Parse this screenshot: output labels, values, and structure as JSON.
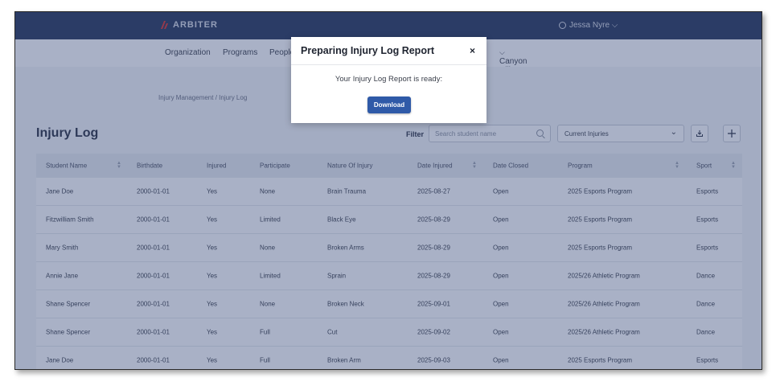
{
  "topbar": {
    "brand": "ARBITER",
    "user_name": "Jessa Nyre ⌵"
  },
  "subnav": {
    "items": [
      "Organization",
      "Programs",
      "People",
      "Canyon Hills High School Acco"
    ]
  },
  "breadcrumb": "Injury Management  /  Injury Log",
  "page": {
    "title": "Injury Log",
    "filter_label": "Filter",
    "search_placeholder": "Search student name",
    "status_filter": "Current Injuries"
  },
  "table": {
    "columns": [
      "Student Name",
      "Birthdate",
      "Injured",
      "Participate",
      "Nature Of Injury",
      "Date Injured",
      "Date Closed",
      "Program",
      "Sport"
    ],
    "rows": [
      [
        "Jane Doe",
        "2000-01-01",
        "Yes",
        "None",
        "Brain Trauma",
        "2025-08-27",
        "Open",
        "2025 Esports Program",
        "Esports"
      ],
      [
        "Fitzwilliam Smith",
        "2000-01-01",
        "Yes",
        "Limited",
        "Black Eye",
        "2025-08-29",
        "Open",
        "2025 Esports Program",
        "Esports"
      ],
      [
        "Mary Smith",
        "2000-01-01",
        "Yes",
        "None",
        "Broken Arms",
        "2025-08-29",
        "Open",
        "2025 Esports Program",
        "Esports"
      ],
      [
        "Annie Jane",
        "2000-01-01",
        "Yes",
        "Limited",
        "Sprain",
        "2025-08-29",
        "Open",
        "2025/26 Athletic Program",
        "Dance"
      ],
      [
        "Shane Spencer",
        "2000-01-01",
        "Yes",
        "None",
        "Broken Neck",
        "2025-09-01",
        "Open",
        "2025/26 Athletic Program",
        "Dance"
      ],
      [
        "Shane Spencer",
        "2000-01-01",
        "Yes",
        "Full",
        "Cut",
        "2025-09-02",
        "Open",
        "2025/26 Athletic Program",
        "Dance"
      ],
      [
        "Jane Doe",
        "2000-01-01",
        "Yes",
        "Full",
        "Broken Arm",
        "2025-09-03",
        "Open",
        "2025 Esports Program",
        "Esports"
      ]
    ]
  },
  "modal": {
    "title": "Preparing Injury Log Report",
    "close": "×",
    "message": "Your Injury Log Report is ready:",
    "button": "Download"
  },
  "colors": {
    "header_bg": "#27365a",
    "accent": "#2f5aa8",
    "logo_red": "#e0322c"
  }
}
